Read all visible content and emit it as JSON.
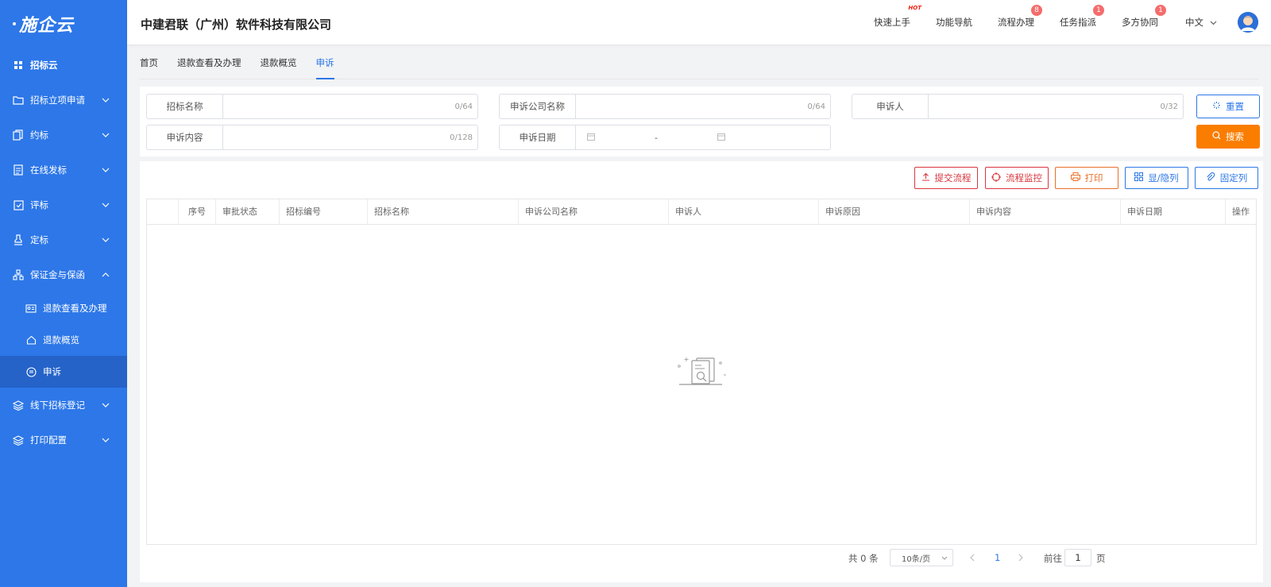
{
  "logo": {
    "text": "施企云"
  },
  "sidebar": {
    "items": [
      {
        "label": "招标云",
        "icon": "grid-icon",
        "chevron": ""
      },
      {
        "label": "招标立项申请",
        "icon": "folder-icon",
        "chevron": "down"
      },
      {
        "label": "约标",
        "icon": "copy-icon",
        "chevron": "down"
      },
      {
        "label": "在线发标",
        "icon": "document-icon",
        "chevron": "down"
      },
      {
        "label": "评标",
        "icon": "check-clipboard-icon",
        "chevron": "down"
      },
      {
        "label": "定标",
        "icon": "stamp-icon",
        "chevron": "down"
      },
      {
        "label": "保证金与保函",
        "icon": "hierarchy-icon",
        "chevron": "up"
      },
      {
        "label": "退款查看及办理",
        "icon": "id-card-icon",
        "sub": true
      },
      {
        "label": "退款概览",
        "icon": "home-icon",
        "sub": true
      },
      {
        "label": "申诉",
        "icon": "appeal-icon",
        "sub": true,
        "active": true
      },
      {
        "label": "线下招标登记",
        "icon": "layers-icon",
        "chevron": "down"
      },
      {
        "label": "打印配置",
        "icon": "layers-icon",
        "chevron": "down"
      }
    ]
  },
  "header": {
    "company": "中建君联（广州）软件科技有限公司",
    "links": {
      "quickstart": "快速上手",
      "hot": "HOT",
      "nav": "功能导航",
      "process": "流程办理",
      "process_badge": "8",
      "task": "任务指派",
      "task_badge": "1",
      "collab": "多方协同",
      "collab_badge": "1"
    },
    "lang": "中文"
  },
  "tabs": [
    "首页",
    "退款查看及办理",
    "退款概览",
    "申诉"
  ],
  "filters": {
    "bid_name": {
      "label": "招标名称",
      "count": "0/64"
    },
    "company": {
      "label": "申诉公司名称",
      "count": "0/64"
    },
    "appellant": {
      "label": "申诉人",
      "count": "0/32"
    },
    "content": {
      "label": "申诉内容",
      "count": "0/128"
    },
    "date": {
      "label": "申诉日期",
      "separator": "-"
    },
    "reset": "重置",
    "search": "搜索"
  },
  "toolbar": {
    "submit": "提交流程",
    "monitor": "流程监控",
    "print": "打印",
    "toggle_cols": "显/隐列",
    "fix_cols": "固定列"
  },
  "table": {
    "columns": [
      "序号",
      "审批状态",
      "招标编号",
      "招标名称",
      "申诉公司名称",
      "申诉人",
      "申诉原因",
      "申诉内容",
      "申诉日期",
      "操作"
    ]
  },
  "pager": {
    "total": "共 0 条",
    "page_size": "10条/页",
    "current": "1",
    "goto_prefix": "前往",
    "goto_value": "1",
    "goto_suffix": "页"
  }
}
